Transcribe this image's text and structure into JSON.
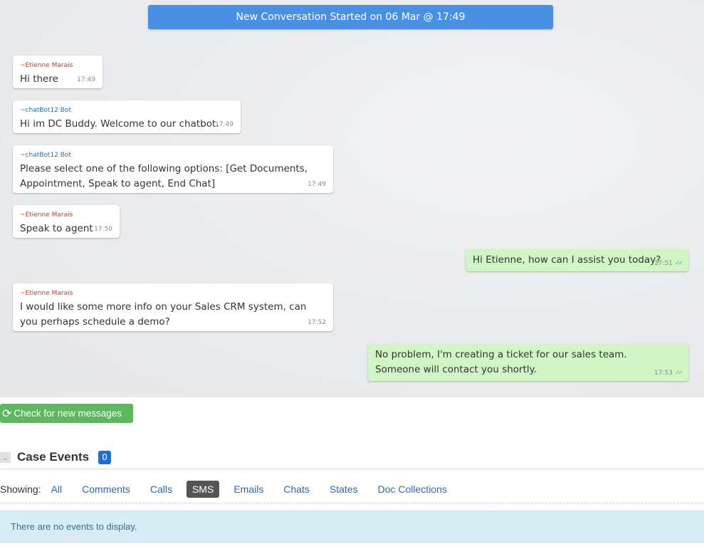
{
  "chat": {
    "banner": "New Conversation Started on 06 Mar @ 17:49",
    "messages": [
      {
        "sender": "~Etienne Marais",
        "text": "Hi there",
        "time": "17:49"
      },
      {
        "sender": "~chatBot12 Bot",
        "text": "Hi im DC Buddy. Welcome to our chatbot.",
        "time": "17:49"
      },
      {
        "sender": "~chatBot12 Bot",
        "text_line1": "Please select one of the following options: [Get Documents,",
        "text_line2": "Appointment, Speak to agent, End Chat]",
        "time": "17:49"
      },
      {
        "sender": "~Etienne Marais",
        "text": "Speak to agent",
        "time": "17:50"
      },
      {
        "text": "Hi Etienne, how can I assist you today?",
        "time": "17:51",
        "status": "read-ticks-icon"
      },
      {
        "sender": "~Etienne Marais",
        "text_line1": "I would like some more info on your Sales CRM system, can",
        "text_line2": "you perhaps schedule a demo?",
        "time": "17:52"
      },
      {
        "text_line1": "No problem, I'm creating a ticket for our sales team.",
        "text_line2": "Someone will contact you shortly.",
        "time": "17:53",
        "status": "delivered-ticks-icon"
      }
    ]
  },
  "check_button": {
    "label": "Check for new messages",
    "icon": "refresh-icon",
    "color": "#5cb85c"
  },
  "case_events": {
    "title": "Case Events",
    "count": "0",
    "showing_label": "Showing:",
    "filters": [
      "All",
      "Comments",
      "Calls",
      "SMS",
      "Emails",
      "Chats",
      "States",
      "Doc Collections"
    ],
    "active_filter": "SMS",
    "empty_message": "There are no events to display."
  },
  "colors": {
    "banner": "#4a90e2",
    "outgoing_bubble": "#d2f5c6",
    "badge": "#1f6fcf",
    "info_bg": "#d9edf7"
  }
}
